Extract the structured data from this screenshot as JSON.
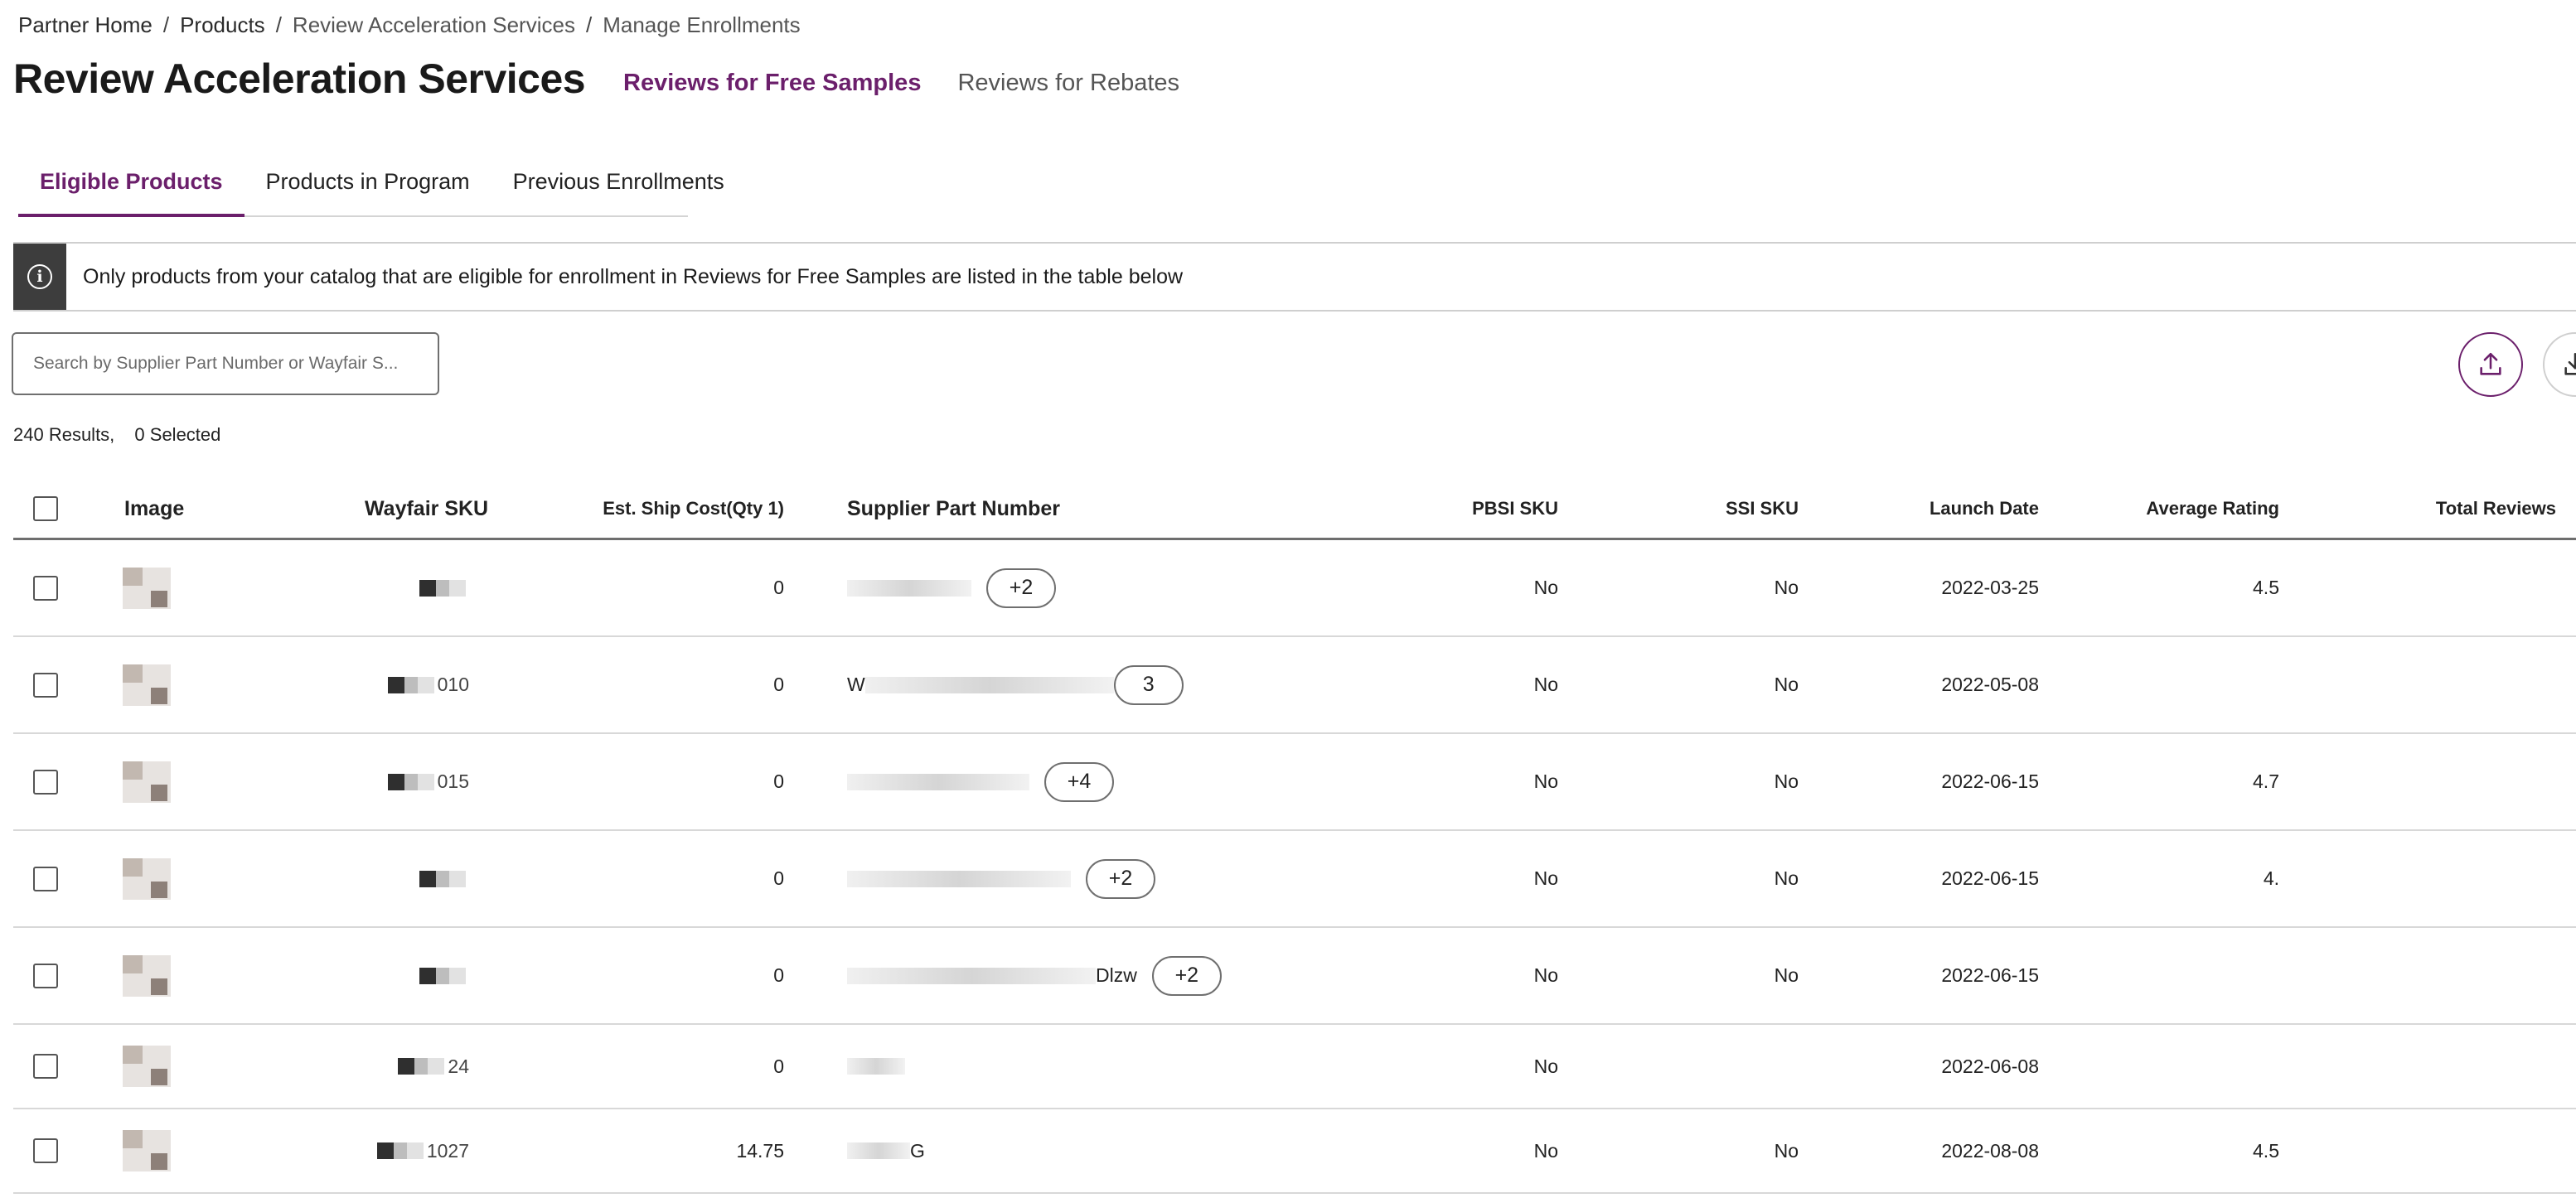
{
  "breadcrumb": [
    "Partner Home",
    "Products",
    "Review Acceleration Services",
    "Manage Enrollments"
  ],
  "page_title": "Review Acceleration Services",
  "program_tabs": [
    {
      "label": "Reviews for Free Samples",
      "active": true
    },
    {
      "label": "Reviews for Rebates",
      "active": false
    }
  ],
  "sub_tabs": [
    {
      "label": "Eligible Products",
      "active": true
    },
    {
      "label": "Products in Program",
      "active": false
    },
    {
      "label": "Previous Enrollments",
      "active": false
    }
  ],
  "info_banner": {
    "icon": "info-icon",
    "text": "Only products from your catalog that are eligible for enrollment in Reviews for Free Samples are listed in the table below"
  },
  "search": {
    "placeholder": "Search by Supplier Part Number or Wayfair S..."
  },
  "actions": {
    "upload_icon": "upload-icon",
    "download_icon": "download-icon"
  },
  "results": {
    "count_text": "240 Results,",
    "selected_text": "0 Selected"
  },
  "table": {
    "columns": {
      "image": "Image",
      "wayfair_sku": "Wayfair SKU",
      "ship_cost": "Est. Ship Cost(Qty 1)",
      "supplier_part": "Supplier Part Number",
      "pbsi_sku": "PBSI SKU",
      "ssi_sku": "SSI SKU",
      "launch_date": "Launch Date",
      "avg_rating": "Average Rating",
      "total_reviews": "Total Reviews"
    },
    "rows": [
      {
        "sku": "",
        "ship_cost": "0",
        "part": "",
        "pill": "+2",
        "pbsi": "No",
        "ssi": "No",
        "launch": "2022-03-25",
        "rating": "4.5",
        "reviews": ""
      },
      {
        "sku": "010",
        "ship_cost": "0",
        "part": "W",
        "pill": "3",
        "pbsi": "No",
        "ssi": "No",
        "launch": "2022-05-08",
        "rating": "",
        "reviews": ""
      },
      {
        "sku": "015",
        "ship_cost": "0",
        "part": "",
        "pill": "+4",
        "pbsi": "No",
        "ssi": "No",
        "launch": "2022-06-15",
        "rating": "4.7",
        "reviews": ""
      },
      {
        "sku": "",
        "ship_cost": "0",
        "part": "",
        "pill": "+2",
        "pbsi": "No",
        "ssi": "No",
        "launch": "2022-06-15",
        "rating": "4.",
        "reviews": ""
      },
      {
        "sku": "",
        "ship_cost": "0",
        "part": "Dlzw",
        "pill": "+2",
        "pbsi": "No",
        "ssi": "No",
        "launch": "2022-06-15",
        "rating": "",
        "reviews": ""
      },
      {
        "sku": "24",
        "ship_cost": "0",
        "part": "",
        "pill": "",
        "pbsi": "No",
        "ssi": "",
        "launch": "2022-06-08",
        "rating": "",
        "reviews": ""
      },
      {
        "sku": "1027",
        "ship_cost": "14.75",
        "part": "G",
        "pill": "",
        "pbsi": "No",
        "ssi": "No",
        "launch": "2022-08-08",
        "rating": "4.5",
        "reviews": ""
      }
    ]
  }
}
